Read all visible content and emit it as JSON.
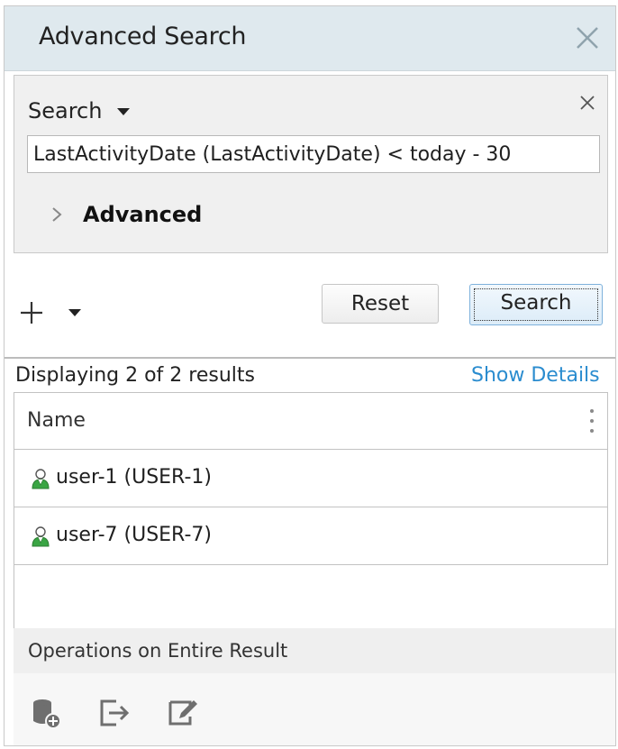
{
  "panel": {
    "title": "Advanced Search",
    "close_icon": "close-icon"
  },
  "search": {
    "label": "Search",
    "query": "LastActivityDate (LastActivityDate) < today - 30",
    "advanced_label": "Advanced"
  },
  "toolbar": {
    "add_icon": "plus-icon",
    "reset_label": "Reset",
    "search_label": "Search"
  },
  "results": {
    "count_text": "Displaying 2 of 2 results",
    "show_details_label": "Show Details",
    "columns": [
      "Name"
    ],
    "rows": [
      {
        "label": "user-1 (USER-1)",
        "icon": "user-icon"
      },
      {
        "label": "user-7 (USER-7)",
        "icon": "user-icon"
      }
    ]
  },
  "operations": {
    "title": "Operations on Entire Result",
    "icons": [
      "database-add-icon",
      "export-icon",
      "edit-icon"
    ]
  },
  "colors": {
    "title_bar": "#dfe9ee",
    "link": "#2a8ccf",
    "user_icon_green": "#3aa544"
  }
}
